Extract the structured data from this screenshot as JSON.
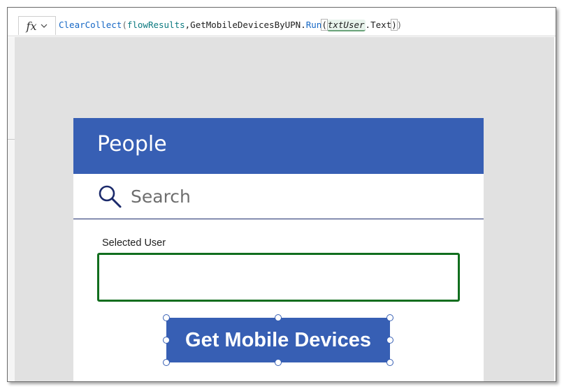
{
  "formula_bar": {
    "fx_label": "fx",
    "tokens": {
      "fn_clearcollect": "ClearCollect",
      "paren_open_1": "(",
      "var_flowresults": "flowResults",
      "comma": ",",
      "connector": "GetMobileDevicesByUPN",
      "dot_1": ".",
      "fn_run": "Run",
      "paren_open_2": "(",
      "ctrl_txtuser": "txtUser",
      "dot_2": ".",
      "prop_text": "Text",
      "paren_close_2": ")",
      "paren_close_1": ")"
    }
  },
  "app": {
    "header_title": "People",
    "search_placeholder": "Search",
    "selected_user_label": "Selected User",
    "selected_user_value": "",
    "button_label": "Get Mobile Devices"
  },
  "colors": {
    "header_bg": "#375fb4",
    "button_bg": "#375fb4",
    "field_border": "#116e1e",
    "canvas_bg": "#e1e1e1"
  },
  "icons": {
    "fx": "fx-icon",
    "chevron": "chevron-down-icon",
    "search": "search-icon"
  }
}
